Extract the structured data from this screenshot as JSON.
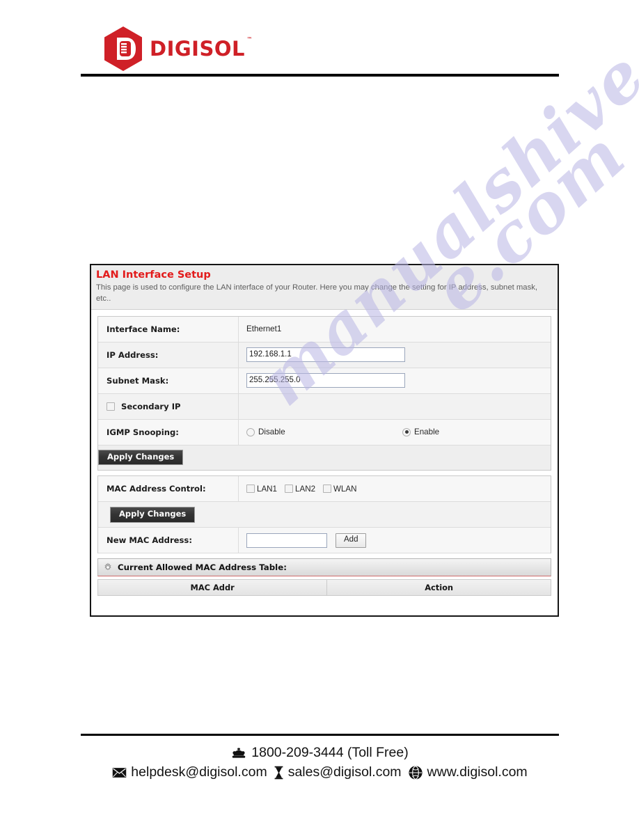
{
  "brand": {
    "logo_text": "DIGISOL",
    "trademark": "™",
    "logo_icon": "digisol-hexagon-logo",
    "color": "#cf2027"
  },
  "panel": {
    "title": "LAN Interface Setup",
    "title_color": "#e21b1b",
    "description": "This page is used to configure the LAN interface of your Router. Here you may change the setting for IP address, subnet mask, etc..",
    "rows": {
      "interface_name": {
        "label": "Interface Name:",
        "value": "Ethernet1"
      },
      "ip_address": {
        "label": "IP Address:",
        "value": "192.168.1.1"
      },
      "subnet_mask": {
        "label": "Subnet Mask:",
        "value": "255.255.255.0"
      },
      "secondary_ip": {
        "label": "Secondary IP",
        "checked": false
      },
      "igmp_snooping": {
        "label": "IGMP Snooping:",
        "options": [
          {
            "label": "Disable",
            "selected": false
          },
          {
            "label": "Enable",
            "selected": true
          }
        ]
      }
    },
    "apply_changes_1": "Apply Changes",
    "mac_control": {
      "label": "MAC Address Control:",
      "checkboxes": [
        {
          "label": "LAN1",
          "checked": false
        },
        {
          "label": "LAN2",
          "checked": false
        },
        {
          "label": "WLAN",
          "checked": false
        }
      ]
    },
    "apply_changes_2": "Apply Changes",
    "new_mac": {
      "label": "New MAC Address:",
      "value": "",
      "add_button": "Add"
    },
    "table": {
      "heading": "Current Allowed MAC Address Table:",
      "heading_icon": "gear-icon",
      "columns": [
        "MAC Addr",
        "Action"
      ],
      "rows": []
    }
  },
  "footer": {
    "phone_icon": "telephone-icon",
    "phone": "1800-209-3444 (Toll Free)",
    "helpdesk_icon": "envelope-icon",
    "helpdesk_email": "helpdesk@digisol.com",
    "sales_icon": "envelope-icon",
    "sales_email": "sales@digisol.com",
    "web_icon": "globe-icon",
    "website": "www.digisol.com"
  },
  "watermark": {
    "line1": "manualshive",
    "line2": "e.com"
  }
}
